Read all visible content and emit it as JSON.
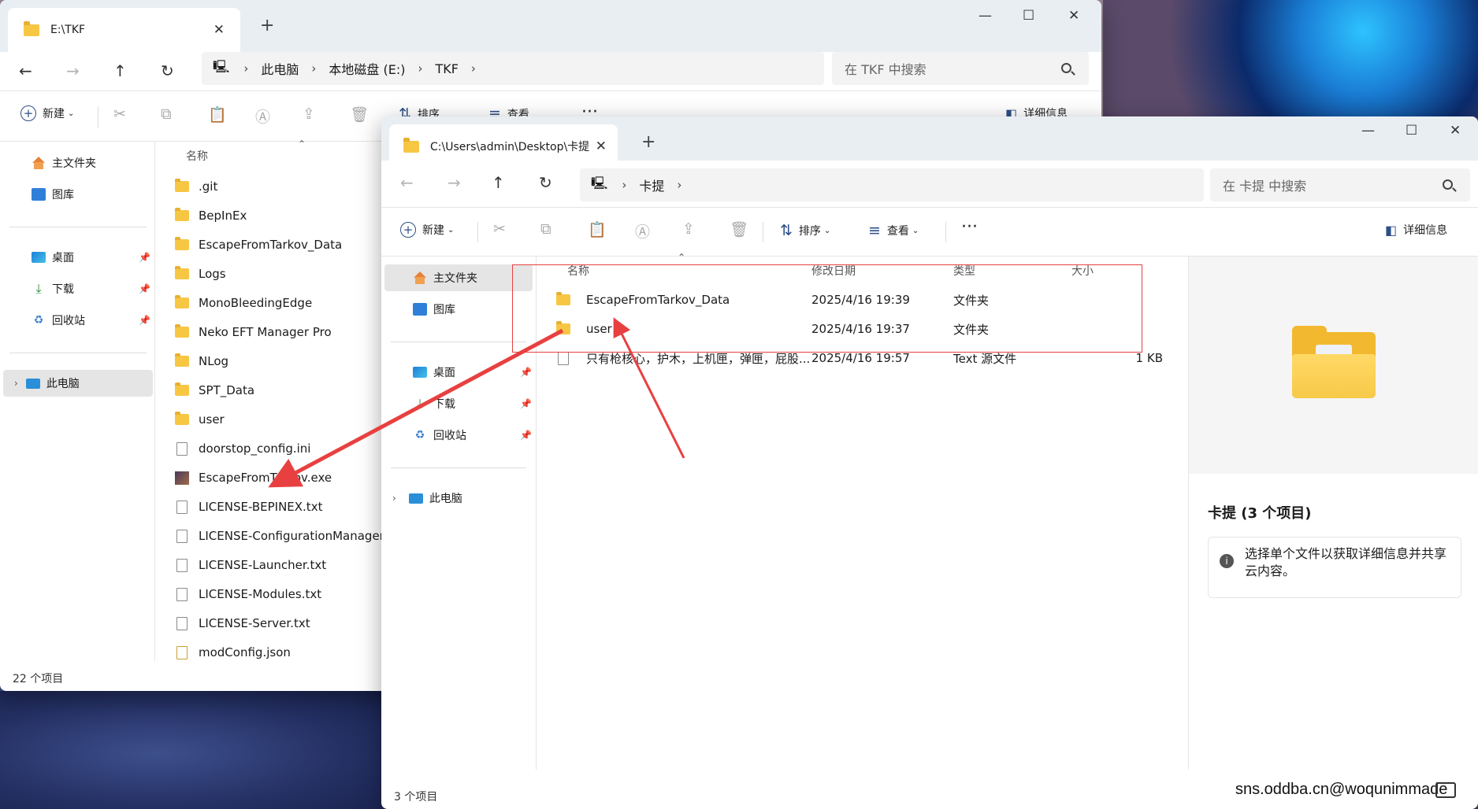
{
  "window1": {
    "tab_title": "E:\\TKF",
    "breadcrumb": [
      "此电脑",
      "本地磁盘 (E:)",
      "TKF"
    ],
    "search_placeholder": "在 TKF 中搜索",
    "toolbar": {
      "new_label": "新建",
      "sort_label": "排序",
      "view_label": "查看",
      "details_label": "详细信息"
    },
    "sidebar": {
      "home": "主文件夹",
      "gallery": "图库",
      "desktop": "桌面",
      "downloads": "下载",
      "recycle": "回收站",
      "this_pc": "此电脑"
    },
    "column_name": "名称",
    "files": [
      {
        "name": ".git",
        "kind": "folder"
      },
      {
        "name": "BepInEx",
        "kind": "folder"
      },
      {
        "name": "EscapeFromTarkov_Data",
        "kind": "folder"
      },
      {
        "name": "Logs",
        "kind": "folder"
      },
      {
        "name": "MonoBleedingEdge",
        "kind": "folder"
      },
      {
        "name": "Neko EFT Manager Pro",
        "kind": "folder"
      },
      {
        "name": "NLog",
        "kind": "folder"
      },
      {
        "name": "SPT_Data",
        "kind": "folder"
      },
      {
        "name": "user",
        "kind": "folder"
      },
      {
        "name": "doorstop_config.ini",
        "kind": "file"
      },
      {
        "name": "EscapeFromTarkov.exe",
        "kind": "exe"
      },
      {
        "name": "LICENSE-BEPINEX.txt",
        "kind": "file"
      },
      {
        "name": "LICENSE-ConfigurationManager.",
        "kind": "file"
      },
      {
        "name": "LICENSE-Launcher.txt",
        "kind": "file"
      },
      {
        "name": "LICENSE-Modules.txt",
        "kind": "file"
      },
      {
        "name": "LICENSE-Server.txt",
        "kind": "file"
      },
      {
        "name": "modConfig.json",
        "kind": "json"
      }
    ],
    "status": "22 个项目"
  },
  "window2": {
    "tab_title": "C:\\Users\\admin\\Desktop\\卡提",
    "breadcrumb": [
      "卡提"
    ],
    "search_placeholder": "在 卡提 中搜索",
    "toolbar": {
      "new_label": "新建",
      "sort_label": "排序",
      "view_label": "查看",
      "details_label": "详细信息"
    },
    "sidebar": {
      "home": "主文件夹",
      "gallery": "图库",
      "desktop": "桌面",
      "downloads": "下载",
      "recycle": "回收站",
      "this_pc": "此电脑"
    },
    "columns": {
      "name": "名称",
      "date": "修改日期",
      "type": "类型",
      "size": "大小"
    },
    "files": [
      {
        "name": "EscapeFromTarkov_Data",
        "date": "2025/4/16 19:39",
        "type": "文件夹",
        "size": "",
        "kind": "folder"
      },
      {
        "name": "user",
        "date": "2025/4/16 19:37",
        "type": "文件夹",
        "size": "",
        "kind": "folder"
      },
      {
        "name": "只有枪核心，护木，上机匣，弹匣，屁股...",
        "date": "2025/4/16 19:57",
        "type": "Text 源文件",
        "size": "1 KB",
        "kind": "file"
      }
    ],
    "details": {
      "title": "卡提 (3 个项目)",
      "info": "选择单个文件以获取详细信息并共享云内容。"
    },
    "status": "3 个项目"
  },
  "watermark": "sns.oddba.cn@woqunimmade",
  "colors": {
    "annotation_red": "#e84040",
    "folder_yellow": "#f7c744",
    "accent_blue": "#2b4f86"
  }
}
